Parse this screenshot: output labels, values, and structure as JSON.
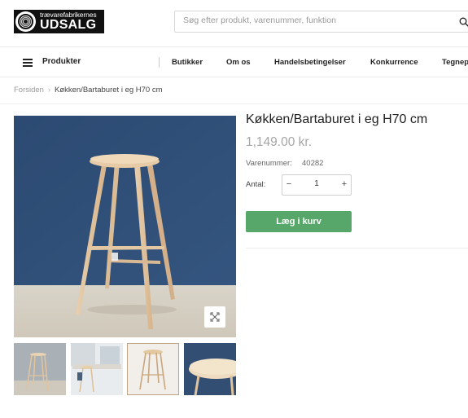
{
  "header": {
    "logo_small": "trævarefabrikernes",
    "logo_big": "UDSALG",
    "search_placeholder": "Søg efter produkt, varenummer, funktion"
  },
  "nav": {
    "products_label": "Produkter",
    "links": [
      "Butikker",
      "Om os",
      "Handelsbetingelser",
      "Konkurrence",
      "Tegnepl"
    ]
  },
  "breadcrumb": {
    "home": "Forsiden",
    "separator": "›",
    "current": "Køkken/Bartaburet i eg H70 cm"
  },
  "product": {
    "title": "Køkken/Bartaburet i eg H70 cm",
    "price": "1,149.00  kr.",
    "sku_label": "Varenummer:",
    "sku": "40282",
    "qty_label": "Antal:",
    "qty_minus": "−",
    "qty_value": "1",
    "qty_plus": "+",
    "add_to_cart": "Læg i kurv"
  },
  "gallery": {
    "thumbnail_count": 4,
    "active_thumbnail": 3
  },
  "colors": {
    "cart_button": "#57a76a",
    "price": "#a5a5a5",
    "background_wall": "#2f4f7a"
  },
  "icons": {
    "search": "search-icon",
    "menu": "menu-icon",
    "zoom": "expand-icon"
  }
}
